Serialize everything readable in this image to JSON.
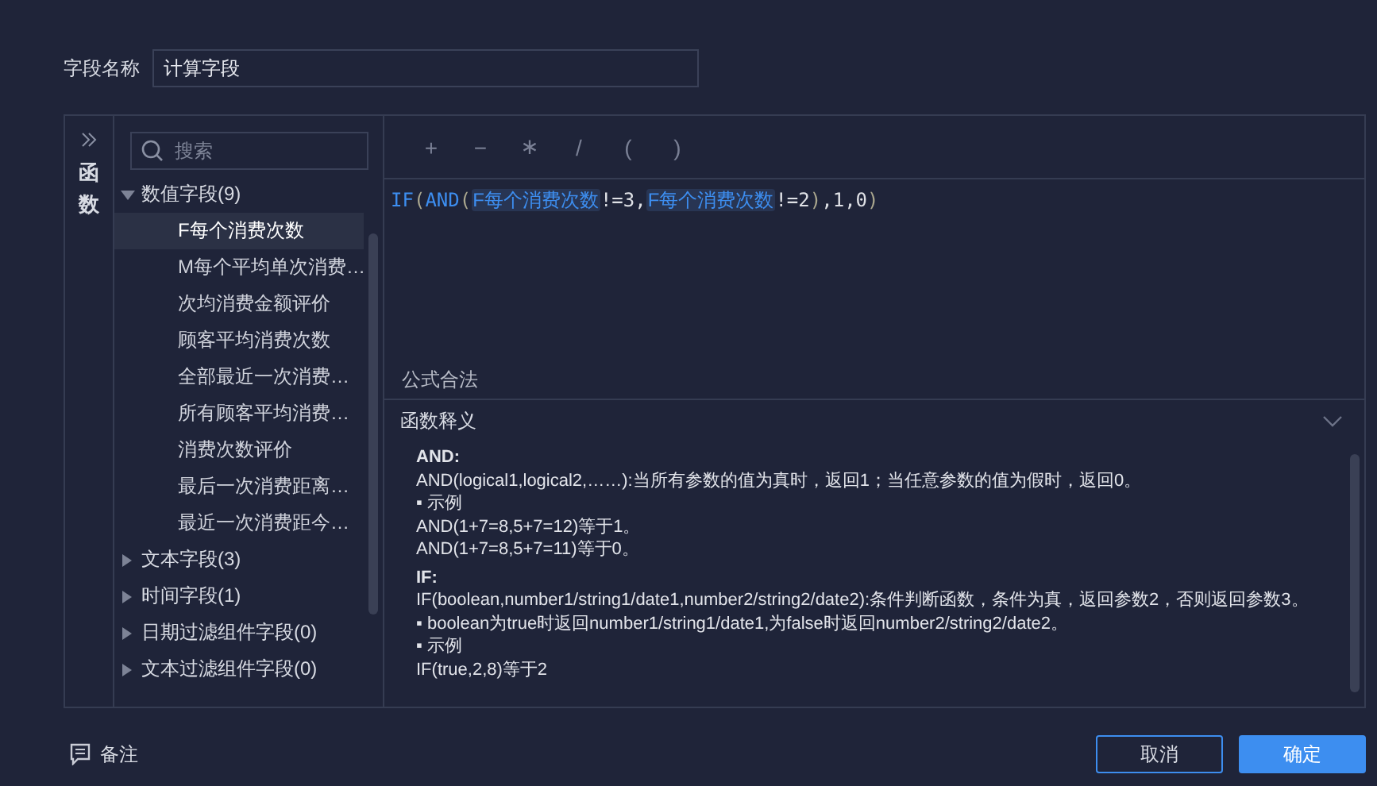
{
  "name_field": {
    "label": "字段名称",
    "value": "计算字段"
  },
  "side_tab": {
    "label": "函数"
  },
  "search": {
    "placeholder": "搜索"
  },
  "tree": [
    {
      "label": "数值字段(9)",
      "expanded": true,
      "children": [
        {
          "label": "F每个消费次数",
          "selected": true
        },
        {
          "label": "M每个平均单次消费…",
          "selected": false
        },
        {
          "label": "次均消费金额评价",
          "selected": false
        },
        {
          "label": "顾客平均消费次数",
          "selected": false
        },
        {
          "label": "全部最近一次消费…",
          "selected": false
        },
        {
          "label": "所有顾客平均消费…",
          "selected": false
        },
        {
          "label": "消费次数评价",
          "selected": false
        },
        {
          "label": "最后一次消费距离…",
          "selected": false
        },
        {
          "label": "最近一次消费距今…",
          "selected": false
        }
      ]
    },
    {
      "label": "文本字段(3)",
      "expanded": false
    },
    {
      "label": "时间字段(1)",
      "expanded": false
    },
    {
      "label": "日期过滤组件字段(0)",
      "expanded": false
    },
    {
      "label": "文本过滤组件字段(0)",
      "expanded": false
    }
  ],
  "operators": [
    "+",
    "−",
    "∗",
    "/",
    "(",
    ")"
  ],
  "formula": [
    {
      "text": "IF",
      "kind": "func"
    },
    {
      "text": "(",
      "kind": "paren"
    },
    {
      "text": "AND",
      "kind": "func"
    },
    {
      "text": "(",
      "kind": "paren"
    },
    {
      "text": "F每个消费次数",
      "kind": "field"
    },
    {
      "text": "!=3,",
      "kind": "plain"
    },
    {
      "text": "F每个消费次数",
      "kind": "field"
    },
    {
      "text": "!=2",
      "kind": "plain"
    },
    {
      "text": ")",
      "kind": "paren"
    },
    {
      "text": ",1,0",
      "kind": "plain"
    },
    {
      "text": ")",
      "kind": "paren"
    }
  ],
  "status": "公式合法",
  "help": {
    "title": "函数释义",
    "expanded": true,
    "lines": [
      {
        "text": "AND:",
        "kind": "heading"
      },
      {
        "text": "AND(logical1,logical2,……):当所有参数的值为真时，返回1；当任意参数的值为假时，返回0。",
        "kind": "text"
      },
      {
        "text": "▪ 示例",
        "kind": "text"
      },
      {
        "text": "AND(1+7=8,5+7=12)等于1。",
        "kind": "text"
      },
      {
        "text": "AND(1+7=8,5+7=11)等于0。",
        "kind": "text"
      },
      {
        "text": "IF:",
        "kind": "heading"
      },
      {
        "text": "IF(boolean,number1/string1/date1,number2/string2/date2):条件判断函数，条件为真，返回参数2，否则返回参数3。",
        "kind": "text"
      },
      {
        "text": "▪ boolean为true时返回number1/string1/date1,为false时返回number2/string2/date2。",
        "kind": "text"
      },
      {
        "text": "▪ 示例",
        "kind": "text"
      },
      {
        "text": "IF(true,2,8)等于2",
        "kind": "text"
      }
    ]
  },
  "note": {
    "label": "备注"
  },
  "buttons": [
    {
      "label": "取消",
      "kind": "secondary"
    },
    {
      "label": "确定",
      "kind": "primary"
    }
  ]
}
